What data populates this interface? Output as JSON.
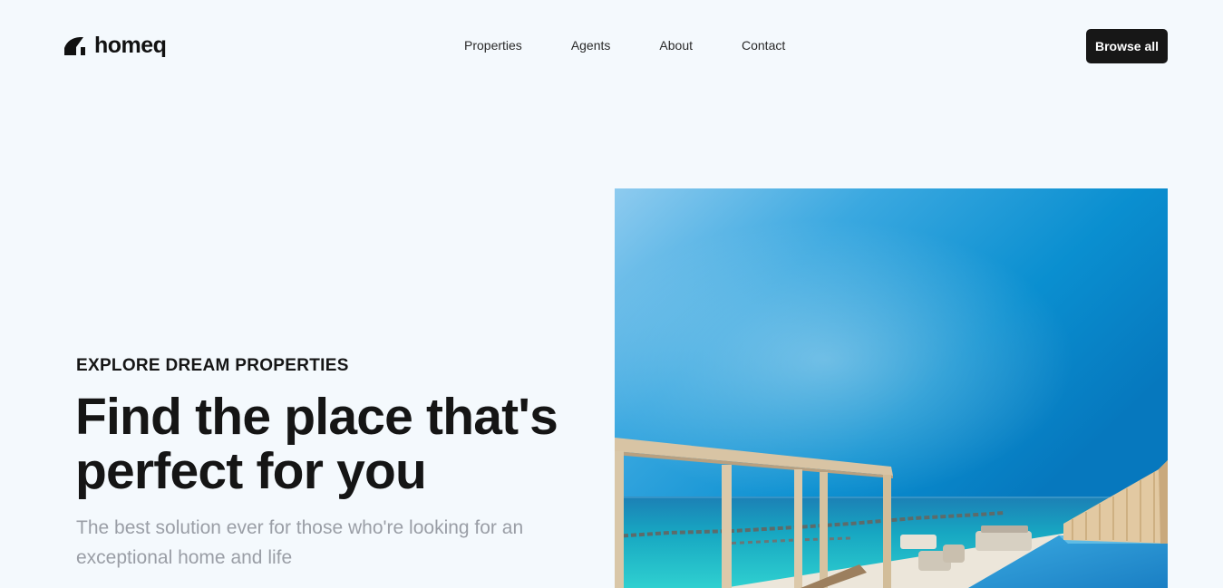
{
  "header": {
    "logo_text": "homeq",
    "nav": [
      "Properties",
      "Agents",
      "About",
      "Contact"
    ],
    "cta_label": "Browse all"
  },
  "hero": {
    "eyebrow": "EXPLORE DREAM PROPERTIES",
    "headline": "Find the place that's perfect for you",
    "subtext": "The best solution ever for those who're looking for an exceptional home and life",
    "image_icon": "resort-pool-photo"
  },
  "colors": {
    "background": "#f4f9fd",
    "button_bg": "#171717",
    "button_text": "#ffffff",
    "muted_text": "#9a9ea6"
  }
}
